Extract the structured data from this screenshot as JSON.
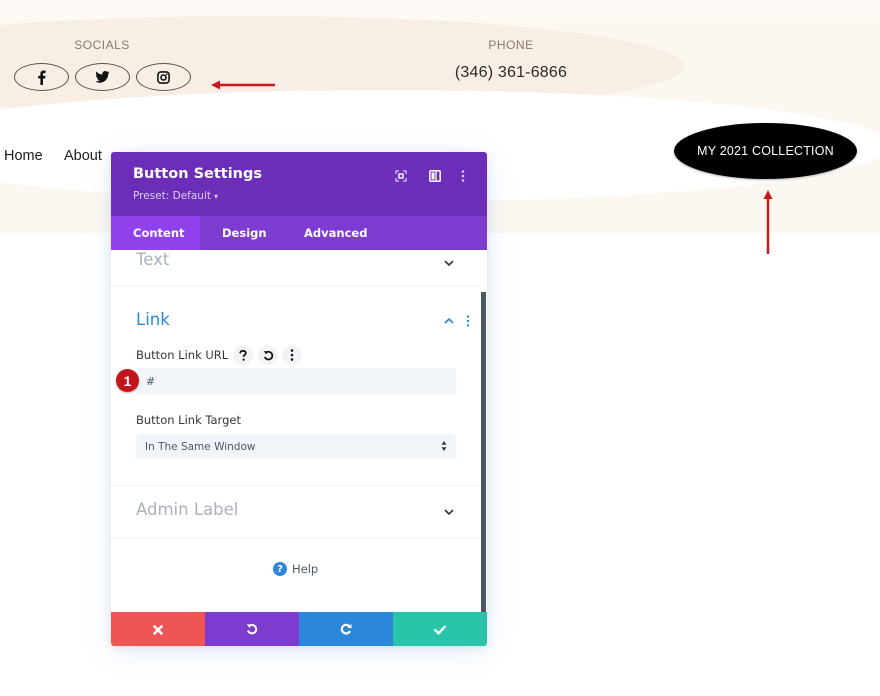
{
  "header": {
    "socials_label": "SOCIALS",
    "social_links": [
      {
        "name": "facebook",
        "icon": "facebook-icon"
      },
      {
        "name": "twitter",
        "icon": "twitter-icon"
      },
      {
        "name": "instagram",
        "icon": "instagram-icon"
      }
    ],
    "phone_label": "PHONE",
    "phone_number": "(346) 361-6866"
  },
  "nav": {
    "items": [
      {
        "label": "Home"
      },
      {
        "label": "About"
      }
    ],
    "cta_button": "MY 2021 COLLECTION"
  },
  "annotations": {
    "arrow_color": "#d0161d",
    "step_badge": "1"
  },
  "modal": {
    "title": "Button Settings",
    "preset": "Preset: Default",
    "header_icons": [
      "expand-icon",
      "split-view-icon",
      "more-vertical-icon"
    ],
    "tabs": [
      {
        "label": "Content",
        "active": true
      },
      {
        "label": "Design",
        "active": false
      },
      {
        "label": "Advanced",
        "active": false
      }
    ],
    "sections": {
      "text": {
        "title": "Text",
        "expanded": false
      },
      "link": {
        "title": "Link",
        "expanded": true,
        "url_label": "Button Link URL",
        "url_value": "#",
        "target_label": "Button Link Target",
        "target_value": "In The Same Window"
      },
      "admin_label": {
        "title": "Admin Label",
        "expanded": false
      }
    },
    "help_label": "Help",
    "footer_buttons": [
      "cancel",
      "undo",
      "redo",
      "save"
    ]
  },
  "colors": {
    "header_purple": "#6c2eb9",
    "tabs_purple": "#7d3bcf",
    "active_tab": "#8f42ec",
    "cancel": "#ef5555",
    "undo": "#7e3bd0",
    "redo": "#2b87da",
    "save": "#29c4a9",
    "link_blue": "#2b87da"
  }
}
